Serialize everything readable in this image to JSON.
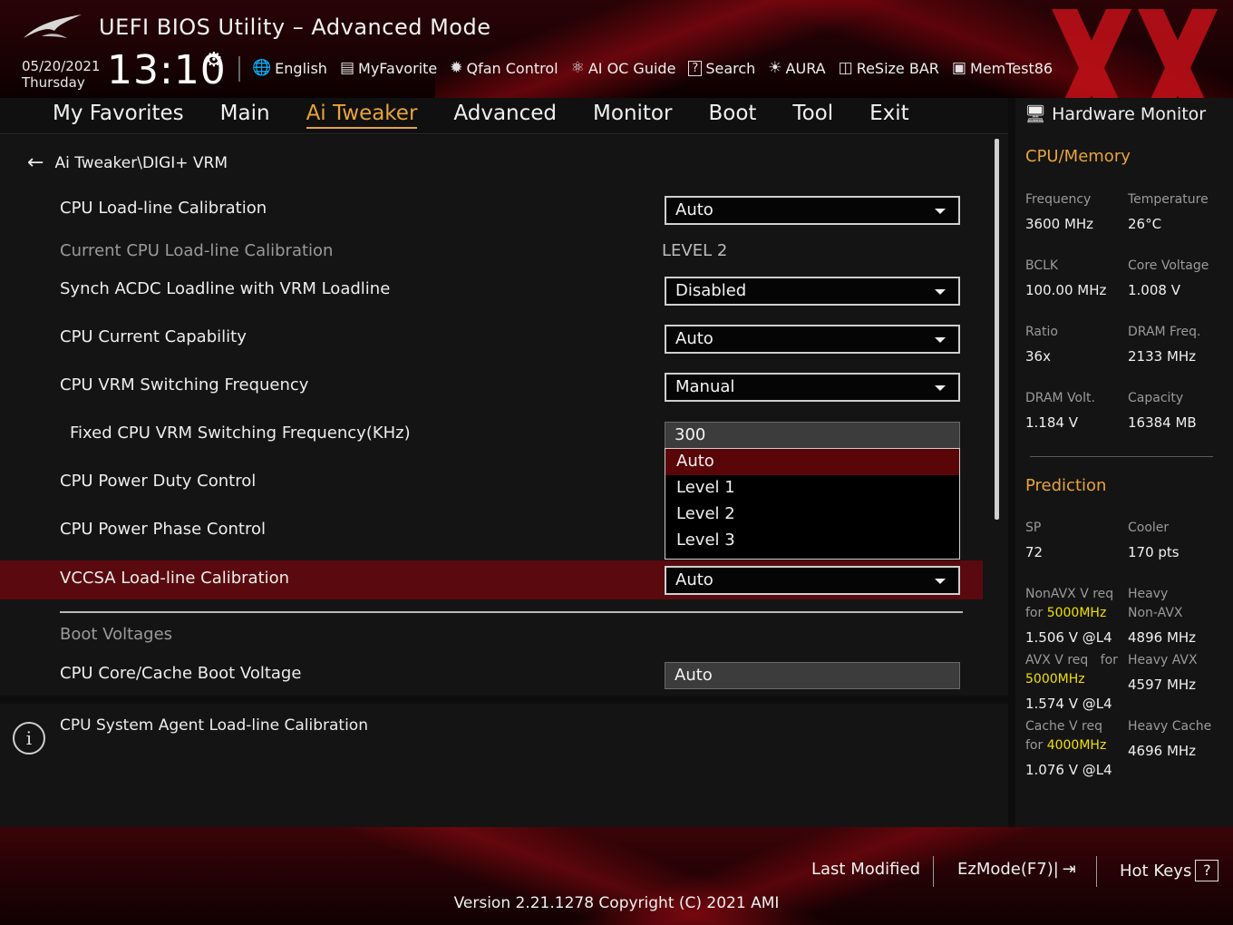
{
  "header": {
    "title": "UEFI BIOS Utility – Advanced Mode",
    "date": "05/20/2021",
    "day": "Thursday",
    "time": "13:10",
    "tools": [
      {
        "label": "English",
        "icon": "globe-icon"
      },
      {
        "label": "MyFavorite",
        "icon": "favorite-icon"
      },
      {
        "label": "Qfan Control",
        "icon": "fan-icon"
      },
      {
        "label": "AI OC Guide",
        "icon": "ai-icon"
      },
      {
        "label": "Search",
        "icon": "search-icon"
      },
      {
        "label": "AURA",
        "icon": "aura-icon"
      },
      {
        "label": "ReSize BAR",
        "icon": "resize-bar-icon"
      },
      {
        "label": "MemTest86",
        "icon": "memtest-icon"
      }
    ]
  },
  "nav": {
    "tabs": [
      "My Favorites",
      "Main",
      "Ai Tweaker",
      "Advanced",
      "Monitor",
      "Boot",
      "Tool",
      "Exit"
    ],
    "active": "Ai Tweaker"
  },
  "main": {
    "breadcrumb": "Ai Tweaker\\DIGI+ VRM",
    "rows": [
      {
        "label": "CPU Load-line Calibration",
        "value": "Auto"
      },
      {
        "label": "Current CPU Load-line Calibration",
        "value": "LEVEL 2"
      },
      {
        "label": "Synch ACDC Loadline with VRM Loadline",
        "value": "Disabled"
      },
      {
        "label": "CPU Current Capability",
        "value": "Auto"
      },
      {
        "label": "CPU VRM Switching Frequency",
        "value": "Manual"
      },
      {
        "label": "Fixed CPU VRM Switching Frequency(KHz)",
        "value": "300"
      },
      {
        "label": "CPU Power Duty Control",
        "value": ""
      },
      {
        "label": "CPU Power Phase Control",
        "value": ""
      },
      {
        "label": "VCCSA Load-line Calibration",
        "value": "Auto"
      }
    ],
    "dropdown_options": [
      "Auto",
      "Level 1",
      "Level 2",
      "Level 3"
    ],
    "dropdown_selected": "Auto",
    "section_boot": "Boot Voltages",
    "boot_row": {
      "label": "CPU Core/Cache Boot Voltage",
      "value": "Auto"
    }
  },
  "help": {
    "text": "CPU System Agent Load-line Calibration"
  },
  "hwmon": {
    "title": "Hardware Monitor",
    "cpu_section": "CPU/Memory",
    "cpu": [
      {
        "label": "Frequency",
        "value": "3600 MHz"
      },
      {
        "label": "Temperature",
        "value": "26°C"
      },
      {
        "label": "BCLK",
        "value": "100.00 MHz"
      },
      {
        "label": "Core Voltage",
        "value": "1.008 V"
      },
      {
        "label": "Ratio",
        "value": "36x"
      },
      {
        "label": "DRAM Freq.",
        "value": "2133 MHz"
      },
      {
        "label": "DRAM Volt.",
        "value": "1.184 V"
      },
      {
        "label": "Capacity",
        "value": "16384 MB"
      }
    ],
    "pred_section": "Prediction",
    "sp_label": "SP",
    "sp_value": "72",
    "cooler_label": "Cooler",
    "cooler_value": "170 pts",
    "nonavx_label1": "NonAVX V req",
    "nonavx_for": "for",
    "nonavx_freq": "5000MHz",
    "nonavx_value": "1.506 V @L4",
    "heavy_nonavx_label1": "Heavy",
    "heavy_nonavx_label2": "Non-AVX",
    "heavy_nonavx_value": "4896 MHz",
    "avx_label1": "AVX V req",
    "avx_for": "for",
    "avx_freq": "5000MHz",
    "avx_value": "1.574 V @L4",
    "heavy_avx_label": "Heavy AVX",
    "heavy_avx_value": "4597 MHz",
    "cache_label1": "Cache V req",
    "cache_for": "for",
    "cache_freq": "4000MHz",
    "cache_value": "1.076 V @L4",
    "heavy_cache_label": "Heavy Cache",
    "heavy_cache_value": "4696 MHz"
  },
  "footer": {
    "last_modified": "Last Modified",
    "ezmode": "EzMode(F7)|",
    "hotkeys": "Hot Keys",
    "hotkeys_key": "?",
    "version": "Version 2.21.1278 Copyright (C) 2021 AMI"
  },
  "colors": {
    "accent": "#e8a33a",
    "highlight_row": "#5a0a0f",
    "prediction_highlight": "#f0e000"
  }
}
